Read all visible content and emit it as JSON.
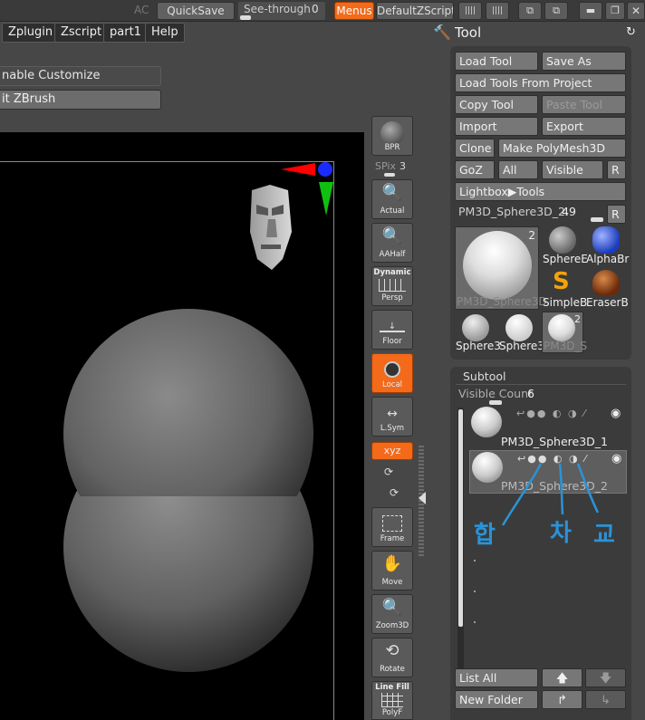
{
  "topbar": {
    "ac_label": "AC",
    "quicksave_label": "QuickSave",
    "seethrough_label": "See-through",
    "seethrough_value": "0",
    "menus_label": "Menus",
    "default_zscript_label": "DefaultZScript"
  },
  "menubar": {
    "items": [
      "Zplugin",
      "Zscript",
      "part1",
      "Help"
    ]
  },
  "left_buttons": {
    "enable_customize": "nable Customize",
    "exit_zbrush": "it ZBrush"
  },
  "shelf": {
    "bpr": "BPR",
    "spix_label": "SPix",
    "spix_value": "3",
    "actual": "Actual",
    "aahalf": "AAHalf",
    "dynamic": "Dynamic",
    "persp": "Persp",
    "floor": "Floor",
    "local": "Local",
    "lsym": "L.Sym",
    "xyz": "xyz",
    "frame": "Frame",
    "move": "Move",
    "zoom3d": "Zoom3D",
    "rotate": "Rotate",
    "line_fill": "Line Fill",
    "polyf": "PolyF"
  },
  "tool_panel": {
    "title": "Tool",
    "load_tool": "Load Tool",
    "save_as": "Save As",
    "load_tools_from_project": "Load Tools From Project",
    "copy_tool": "Copy Tool",
    "paste_tool": "Paste Tool",
    "import": "Import",
    "export": "Export",
    "clone": "Clone",
    "make_polymesh": "Make PolyMesh3D",
    "goz": "GoZ",
    "all": "All",
    "visible": "Visible",
    "r": "R",
    "lightbox_tools": "Lightbox▶Tools",
    "current_tool": "PM3D_Sphere3D_2.",
    "current_tool_count": "49",
    "thumbs": {
      "main_label": "PM3D_Sphere3D",
      "main_count": "2",
      "sphere_b": "SphereE",
      "alpha_b": "AlphaBr",
      "simple_b": "SimpleB",
      "eraser_b": "EraserB",
      "small1": "Sphere3",
      "small2": "Sphere3",
      "small3": "PM3D_S",
      "small3_count": "2"
    }
  },
  "subtool": {
    "title": "Subtool",
    "visible_count_label": "Visible Count",
    "visible_count": "6",
    "items": [
      {
        "name": "PM3D_Sphere3D_1"
      },
      {
        "name": "PM3D_Sphere3D_2"
      }
    ],
    "list_all": "List All",
    "new_folder": "New Folder"
  },
  "annotations": {
    "left": "합",
    "middle": "차",
    "right": "교",
    "color": "#2a93d8"
  },
  "colors": {
    "accent_orange": "#f36a1a",
    "canvas_bg": "#000000"
  }
}
